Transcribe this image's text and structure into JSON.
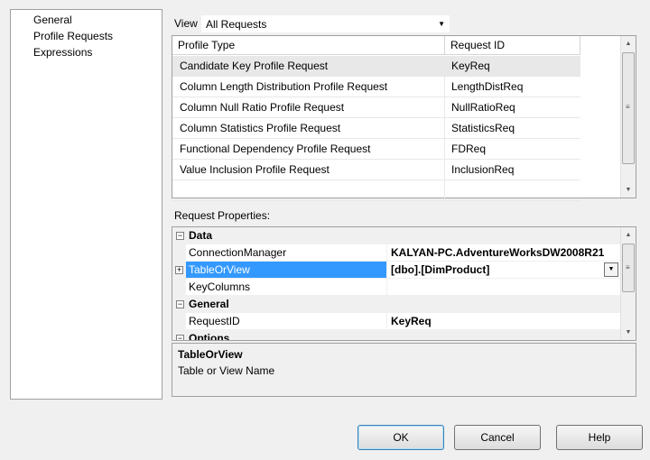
{
  "nav": {
    "items": [
      "General",
      "Profile Requests",
      "Expressions"
    ]
  },
  "view": {
    "label": "View",
    "selected": "All Requests"
  },
  "profile_table": {
    "headers": [
      "Profile Type",
      "Request ID"
    ],
    "rows": [
      [
        "Candidate Key Profile Request",
        "KeyReq"
      ],
      [
        "Column Length Distribution Profile Request",
        "LengthDistReq"
      ],
      [
        "Column Null Ratio Profile Request",
        "NullRatioReq"
      ],
      [
        "Column Statistics Profile Request",
        "StatisticsReq"
      ],
      [
        "Functional Dependency Profile Request",
        "FDReq"
      ],
      [
        "Value Inclusion Profile Request",
        "InclusionReq"
      ]
    ],
    "selected_row": 0
  },
  "request_properties": {
    "label": "Request Properties:",
    "data_category": "Data",
    "connection_manager": {
      "name": "ConnectionManager",
      "value": "KALYAN-PC.AdventureWorksDW2008R21"
    },
    "table_or_view": {
      "name": "TableOrView",
      "value": "[dbo].[DimProduct]"
    },
    "key_columns": {
      "name": "KeyColumns",
      "value": ""
    },
    "general_category": "General",
    "request_id": {
      "name": "RequestID",
      "value": "KeyReq"
    },
    "options_category": "Options"
  },
  "description": {
    "title": "TableOrView",
    "text": "Table or View Name"
  },
  "buttons": {
    "ok": "OK",
    "cancel": "Cancel",
    "help": "Help"
  }
}
